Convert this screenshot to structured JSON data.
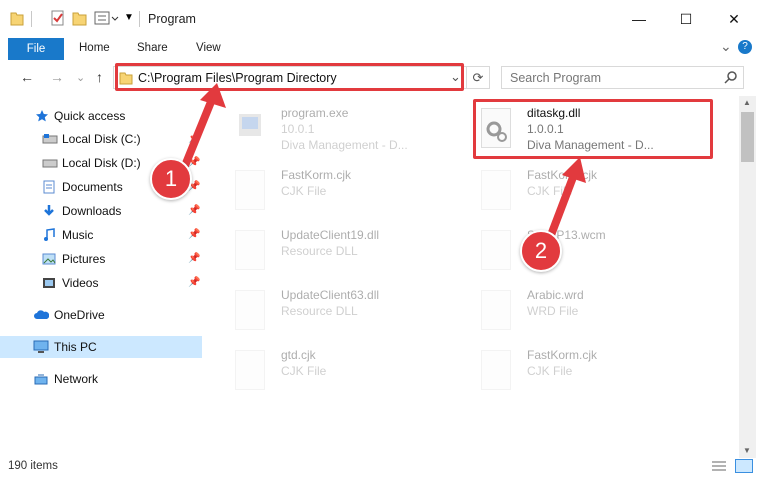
{
  "window": {
    "title": "Program",
    "minimize": "—",
    "maximize": "☐",
    "close": "✕"
  },
  "ribbon": {
    "file": "File",
    "tabs": [
      "Home",
      "Share",
      "View"
    ],
    "collapse": "⌄",
    "help": "?"
  },
  "address": {
    "path": "C:\\Program Files\\Program Directory",
    "dropdown": "⌄",
    "refresh": "⟳"
  },
  "search": {
    "placeholder": "Search Program"
  },
  "nav": {
    "back": "←",
    "forward": "→",
    "recent": "⌄",
    "up": "↑"
  },
  "sidebar": {
    "items": [
      {
        "label": "Quick access",
        "icon": "star-icon"
      },
      {
        "label": "Local Disk (C:)",
        "icon": "drive-icon"
      },
      {
        "label": "Local Disk (D:)",
        "icon": "drive-icon"
      },
      {
        "label": "Documents",
        "icon": "documents-icon"
      },
      {
        "label": "Downloads",
        "icon": "downloads-icon"
      },
      {
        "label": "Music",
        "icon": "music-icon"
      },
      {
        "label": "Pictures",
        "icon": "pictures-icon"
      },
      {
        "label": "Videos",
        "icon": "videos-icon"
      },
      {
        "label": "OneDrive",
        "icon": "cloud-icon"
      },
      {
        "label": "This PC",
        "icon": "computer-icon"
      },
      {
        "label": "Network",
        "icon": "network-icon"
      }
    ]
  },
  "files": [
    {
      "name": "program.exe",
      "line2": "10.0.1",
      "line3": "Diva Management - D..."
    },
    {
      "name": "ditaskg.dll",
      "line2": "1.0.0.1",
      "line3": "Diva Management - D..."
    },
    {
      "name": "FastKorm.cjk",
      "line2": "CJK File",
      "line3": ""
    },
    {
      "name": "FastKorm.cjk",
      "line2": "CJK File",
      "line3": ""
    },
    {
      "name": "UpdateClient19.dll",
      "line2": "Resource DLL",
      "line3": ""
    },
    {
      "name": "S...WP13.wcm",
      "line2": "",
      "line3": ""
    },
    {
      "name": "UpdateClient63.dll",
      "line2": "Resource DLL",
      "line3": ""
    },
    {
      "name": "Arabic.wrd",
      "line2": "WRD File",
      "line3": ""
    },
    {
      "name": "gtd.cjk",
      "line2": "CJK File",
      "line3": ""
    },
    {
      "name": "FastKorm.cjk",
      "line2": "CJK File",
      "line3": ""
    }
  ],
  "status": {
    "count": "190 items"
  },
  "callouts": [
    "1",
    "2"
  ],
  "colors": {
    "accent": "#1979ca",
    "highlight": "#e23a3e",
    "selected": "#cce8ff"
  }
}
